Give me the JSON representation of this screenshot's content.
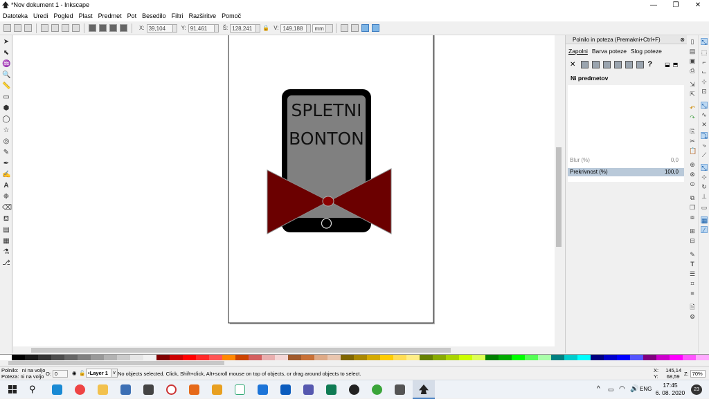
{
  "window": {
    "title": "*Nov dokument 1 - Inkscape",
    "minimize_glyph": "—",
    "maximize_glyph": "❐",
    "close_glyph": "✕"
  },
  "menu": [
    "Datoteka",
    "Uredi",
    "Pogled",
    "Plast",
    "Predmet",
    "Pot",
    "Besedilo",
    "Filtri",
    "Razširitve",
    "Pomoč"
  ],
  "toolcontrols": {
    "x_label": "X:",
    "x_value": "39,104",
    "y_label": "Y:",
    "y_value": "91,461",
    "w_label": "Š:",
    "w_value": "128,241",
    "h_label": "V:",
    "h_value": "149,188",
    "unit": "mm",
    "lock_glyph": "🔒"
  },
  "drawing": {
    "line1": "SPLETNI",
    "line2": "BONTON",
    "colors": {
      "phone_body": "#000000",
      "screen": "#808080",
      "bow": "#6b0000",
      "bow_stroke": "#8a8a8a",
      "page_border": "#222222"
    }
  },
  "dock": {
    "header": "Polnilo in poteza (Premakni+Ctrl+F)",
    "tabs": [
      "Zapolni",
      "Barva poteze",
      "Slog poteze"
    ],
    "no_paint_glyph": "✕",
    "unknown_glyph": "?",
    "nothing_selected": "Ni predmetov",
    "blur_label": "Blur (%)",
    "blur_value": "0,0",
    "opacity_label": "Prekrivnost (%)",
    "opacity_value": "100,0"
  },
  "status": {
    "fill_label": "Polnilo:",
    "fill_value": "ni na voljo",
    "stroke_label": "Poteza:",
    "stroke_value": "ni na voljo",
    "opacity_label": "O:",
    "opacity_value": "0",
    "layer": "•Layer 1",
    "message": "No objects selected. Click, Shift+click, Alt+scroll mouse on top of objects, or drag around objects to select.",
    "cursor_x_label": "X:",
    "cursor_x": "145,14",
    "cursor_y_label": "Y:",
    "cursor_y": "68,59",
    "zoom_label": "Z:",
    "zoom": "70%"
  },
  "taskbar": {
    "time": "17:45",
    "date": "6. 08. 2020",
    "notification_count": "23",
    "language": "ENG",
    "search_glyph": "⚲",
    "tray_up_glyph": "^"
  }
}
